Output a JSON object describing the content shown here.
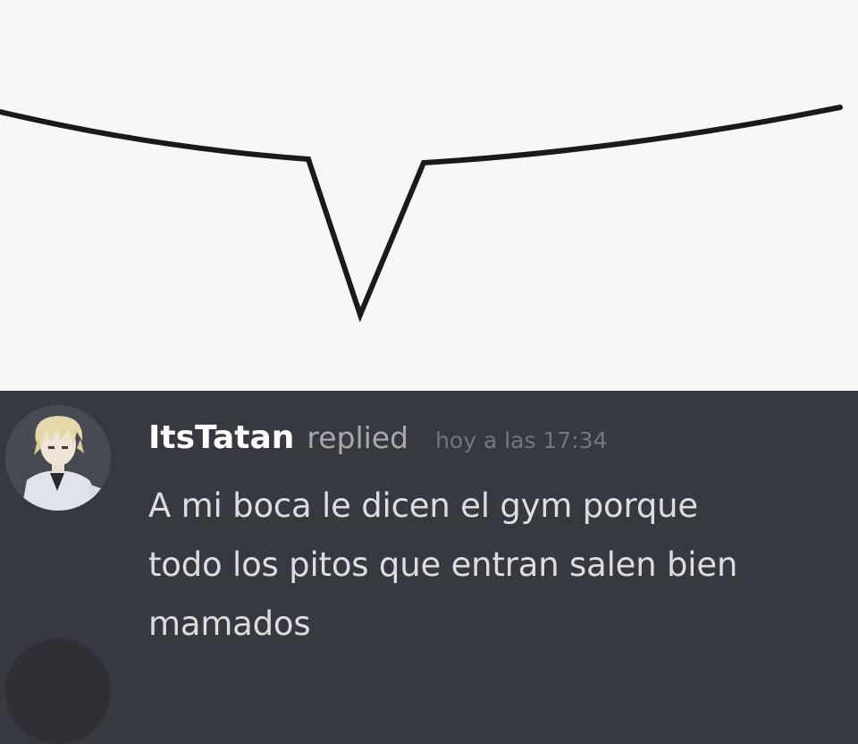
{
  "message": {
    "username": "ItsTatan",
    "action": "replied",
    "timestamp": "hoy a las 17:34",
    "lines": [
      "A mi boca le dicen el gym porque",
      "todo los pitos que entran salen bien",
      "mamados"
    ]
  },
  "colors": {
    "top_background": "#f7f7f7",
    "chat_background": "#36393f",
    "username": "#ffffff",
    "message_text": "#dcddde",
    "timestamp": "#72767d"
  },
  "icons": {
    "avatar": "anime-character-avatar"
  }
}
